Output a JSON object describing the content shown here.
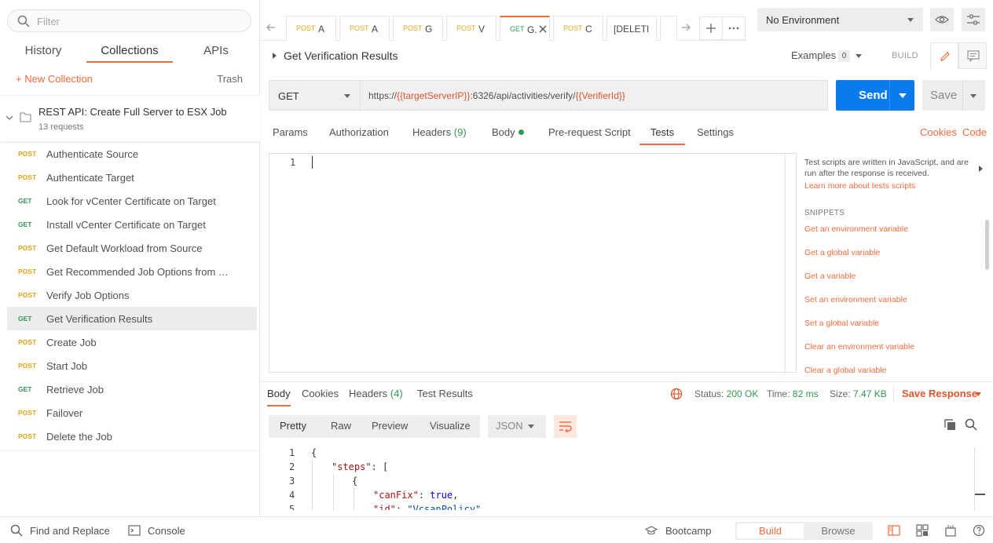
{
  "sidebar": {
    "filter_placeholder": "Filter",
    "tabs": [
      "History",
      "Collections",
      "APIs"
    ],
    "new_collection": "+ New Collection",
    "trash": "Trash",
    "collection": {
      "name": "REST API: Create Full Server to ESX Job",
      "count": "13 requests"
    },
    "requests": [
      {
        "method": "POST",
        "name": "Authenticate Source"
      },
      {
        "method": "POST",
        "name": "Authenticate Target"
      },
      {
        "method": "GET",
        "name": "Look for vCenter Certificate on Target"
      },
      {
        "method": "GET",
        "name": "Install vCenter Certificate on Target"
      },
      {
        "method": "POST",
        "name": "Get Default Workload from Source"
      },
      {
        "method": "POST",
        "name": "Get Recommended Job Options from T..."
      },
      {
        "method": "POST",
        "name": "Verify Job Options"
      },
      {
        "method": "GET",
        "name": "Get Verification Results"
      },
      {
        "method": "POST",
        "name": "Create Job"
      },
      {
        "method": "POST",
        "name": "Start Job"
      },
      {
        "method": "GET",
        "name": "Retrieve Job"
      },
      {
        "method": "POST",
        "name": "Failover"
      },
      {
        "method": "POST",
        "name": "Delete the Job"
      }
    ]
  },
  "tabs": [
    {
      "method": "POST",
      "title": "A"
    },
    {
      "method": "POST",
      "title": "A"
    },
    {
      "method": "POST",
      "title": "G"
    },
    {
      "method": "POST",
      "title": "V"
    },
    {
      "method": "GET",
      "title": "G."
    },
    {
      "method": "POST",
      "title": "C"
    },
    {
      "method": "",
      "title": "[DELETI"
    }
  ],
  "environment": {
    "selected": "No Environment"
  },
  "request": {
    "title": "Get Verification Results",
    "examples_label": "Examples",
    "examples_count": "0",
    "build_label": "BUILD",
    "method": "GET",
    "url_prefix": "https://",
    "url_var1": "{{targetServerIP}}",
    "url_mid": ":6326/api/activities/verify/",
    "url_var2": "{{VerifierId}}",
    "send_label": "Send",
    "save_label": "Save"
  },
  "request_tabs": {
    "params": "Params",
    "authorization": "Authorization",
    "headers": "Headers",
    "headers_count": "(9)",
    "body": "Body",
    "prerequest": "Pre-request Script",
    "tests": "Tests",
    "settings": "Settings",
    "cookies": "Cookies",
    "code": "Code"
  },
  "editor": {
    "line": "1"
  },
  "snippets": {
    "description": "Test scripts are written in JavaScript, and are run after the response is received.",
    "learn_more": "Learn more about tests scripts",
    "heading": "SNIPPETS",
    "items": [
      "Get an environment variable",
      "Get a global variable",
      "Get a variable",
      "Set an environment variable",
      "Set a global variable",
      "Clear an environment variable",
      "Clear a global variable"
    ]
  },
  "response": {
    "tabs": {
      "body": "Body",
      "cookies": "Cookies",
      "headers": "Headers",
      "headers_count": "(4)",
      "test_results": "Test Results"
    },
    "status_label": "Status:",
    "status_value": "200 OK",
    "time_label": "Time:",
    "time_value": "82 ms",
    "size_label": "Size:",
    "size_value": "7.47 KB",
    "save_response": "Save Response",
    "formats": [
      "Pretty",
      "Raw",
      "Preview",
      "Visualize"
    ],
    "language": "JSON",
    "code_lines": [
      {
        "n": "1",
        "text": "{"
      },
      {
        "n": "2",
        "key": "\"steps\"",
        "rest": ": ["
      },
      {
        "n": "3",
        "text": "{"
      },
      {
        "n": "4",
        "key": "\"canFix\"",
        "rest": ": ",
        "kw": "true",
        "tail": ","
      },
      {
        "n": "5",
        "key": "\"id\"",
        "rest": ": ",
        "str": "\"VcsanPolicy\""
      }
    ]
  },
  "footer": {
    "find_replace": "Find and Replace",
    "console": "Console",
    "bootcamp": "Bootcamp",
    "build": "Build",
    "browse": "Browse"
  }
}
